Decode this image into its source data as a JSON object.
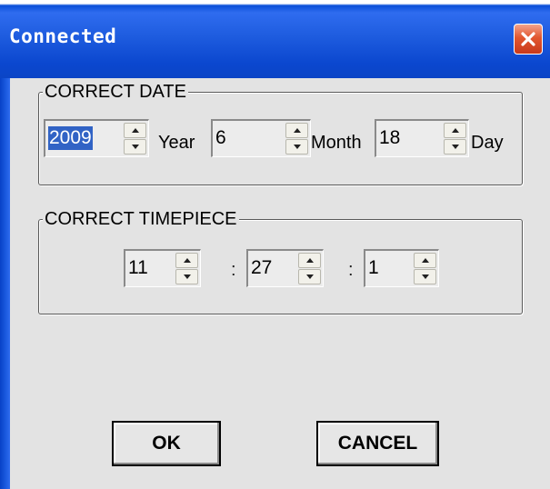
{
  "window": {
    "title": "Connected"
  },
  "date_group": {
    "legend": "CORRECT DATE",
    "year": {
      "value": "2009",
      "label": "Year"
    },
    "month": {
      "value": "6",
      "label": "Month"
    },
    "day": {
      "value": "18",
      "label": "Day"
    }
  },
  "time_group": {
    "legend": "CORRECT TIMEPIECE",
    "hour": "11",
    "minute": "27",
    "second": "1",
    "separator": ":"
  },
  "buttons": {
    "ok": "OK",
    "cancel": "CANCEL"
  },
  "icons": {
    "close": "close-icon",
    "spin_up": "arrow-up-icon",
    "spin_down": "arrow-down-icon"
  },
  "colors": {
    "title_bar": "#1e5cdf",
    "close_button": "#e2572f",
    "client_bg": "#e3e3e3",
    "selection": "#3163c5"
  }
}
